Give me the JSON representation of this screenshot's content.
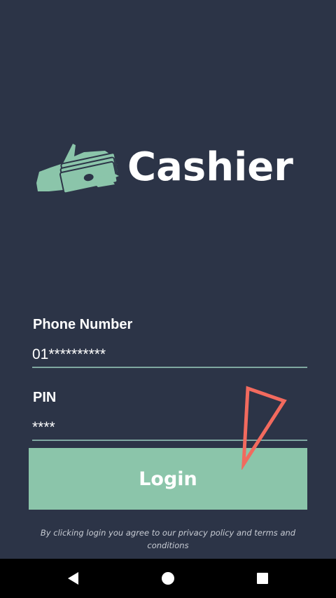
{
  "app": {
    "name": "Cashier"
  },
  "form": {
    "phone": {
      "label": "Phone Number",
      "value": "01**********"
    },
    "pin": {
      "label": "PIN",
      "value": "****"
    },
    "login_label": "Login"
  },
  "terms_text": "By clicking login you agree to our privacy policy and terms and conditions",
  "navigation": {
    "back_icon": "back-triangle-icon",
    "home_icon": "home-circle-icon",
    "recents_icon": "recents-square-icon"
  },
  "colors": {
    "background": "#2c3447",
    "accent": "#8bc5aa",
    "annotation": "#f26a5e"
  }
}
